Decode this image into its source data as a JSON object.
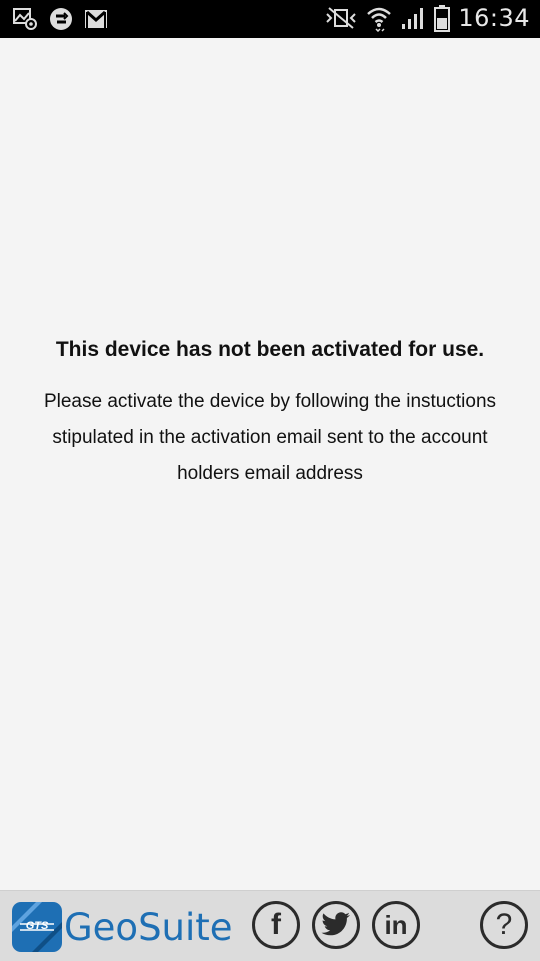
{
  "status_bar": {
    "left_icons": [
      "gallery-at-icon",
      "sync-app-icon",
      "gmail-icon"
    ],
    "right_icons": [
      "vibrate-mute-icon",
      "wifi-icon",
      "signal-icon",
      "battery-icon"
    ],
    "time": "16:34"
  },
  "main": {
    "heading": "This device has not been activated for use.",
    "body_lines": [
      "Please activate the device by following the instuctions",
      "stipulated in the activation email sent to the account",
      "holders email address"
    ]
  },
  "footer": {
    "logo_mark": "GTS",
    "logo_text": "GeoSuite",
    "social": {
      "facebook": "f",
      "linkedin": "in"
    },
    "help": "?",
    "colors": {
      "brand_blue": "#1e6fb4",
      "icon_dark": "#2b2b2b",
      "footer_bg": "#dcdcdc"
    }
  }
}
